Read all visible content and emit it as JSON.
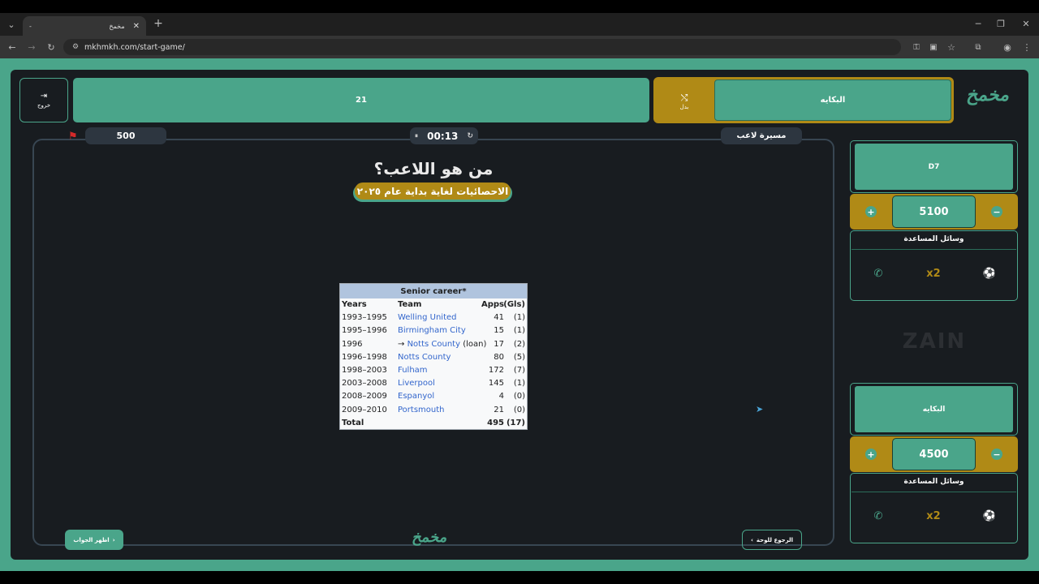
{
  "browser": {
    "tab_title": "مخمخ",
    "tab_left": "-",
    "url": "mkhmkh.com/start-game/"
  },
  "header": {
    "exit_label": "خروج",
    "question_number": "21",
    "team_top_name": "البكايه",
    "swap_label": "بدل",
    "logo_text": "مخمخ"
  },
  "stage": {
    "points": "500",
    "timer": "00:13",
    "category": "مسيرة لاعب",
    "question": "من هو اللاعب؟",
    "subtitle": "الاحصائيات لغاية بداية عام ٢٠٢٥",
    "show_answer": "اظهر الجواب",
    "back_to_board": "الرجوع للوحة"
  },
  "career_table": {
    "title": "Senior career*",
    "headers": [
      "Years",
      "Team",
      "Apps",
      "(Gls)"
    ],
    "rows": [
      {
        "years": "1993–1995",
        "team": "Welling United",
        "prefix": "",
        "suffix": "",
        "apps": "41",
        "gls": "(1)"
      },
      {
        "years": "1995–1996",
        "team": "Birmingham City",
        "prefix": "",
        "suffix": "",
        "apps": "15",
        "gls": "(1)"
      },
      {
        "years": "1996",
        "team": "Notts County",
        "prefix": "→ ",
        "suffix": " (loan)",
        "apps": "17",
        "gls": "(2)"
      },
      {
        "years": "1996–1998",
        "team": "Notts County",
        "prefix": "",
        "suffix": "",
        "apps": "80",
        "gls": "(5)"
      },
      {
        "years": "1998–2003",
        "team": "Fulham",
        "prefix": "",
        "suffix": "",
        "apps": "172",
        "gls": "(7)"
      },
      {
        "years": "2003–2008",
        "team": "Liverpool",
        "prefix": "",
        "suffix": "",
        "apps": "145",
        "gls": "(1)"
      },
      {
        "years": "2008–2009",
        "team": "Espanyol",
        "prefix": "",
        "suffix": "",
        "apps": "4",
        "gls": "(0)"
      },
      {
        "years": "2009–2010",
        "team": "Portsmouth",
        "prefix": "",
        "suffix": "",
        "apps": "21",
        "gls": "(0)"
      }
    ],
    "total_label": "Total",
    "total_apps": "495",
    "total_gls": "(17)"
  },
  "teams": [
    {
      "name": "D7",
      "score": "5100",
      "helps_title": "وسائل المساعدة"
    },
    {
      "name": "البكايه",
      "score": "4500",
      "helps_title": "وسائل المساعدة"
    }
  ],
  "sponsor": "ZAIN",
  "colors": {
    "accent": "#4aa58a",
    "gold": "#b08a16",
    "background": "#181c20"
  }
}
